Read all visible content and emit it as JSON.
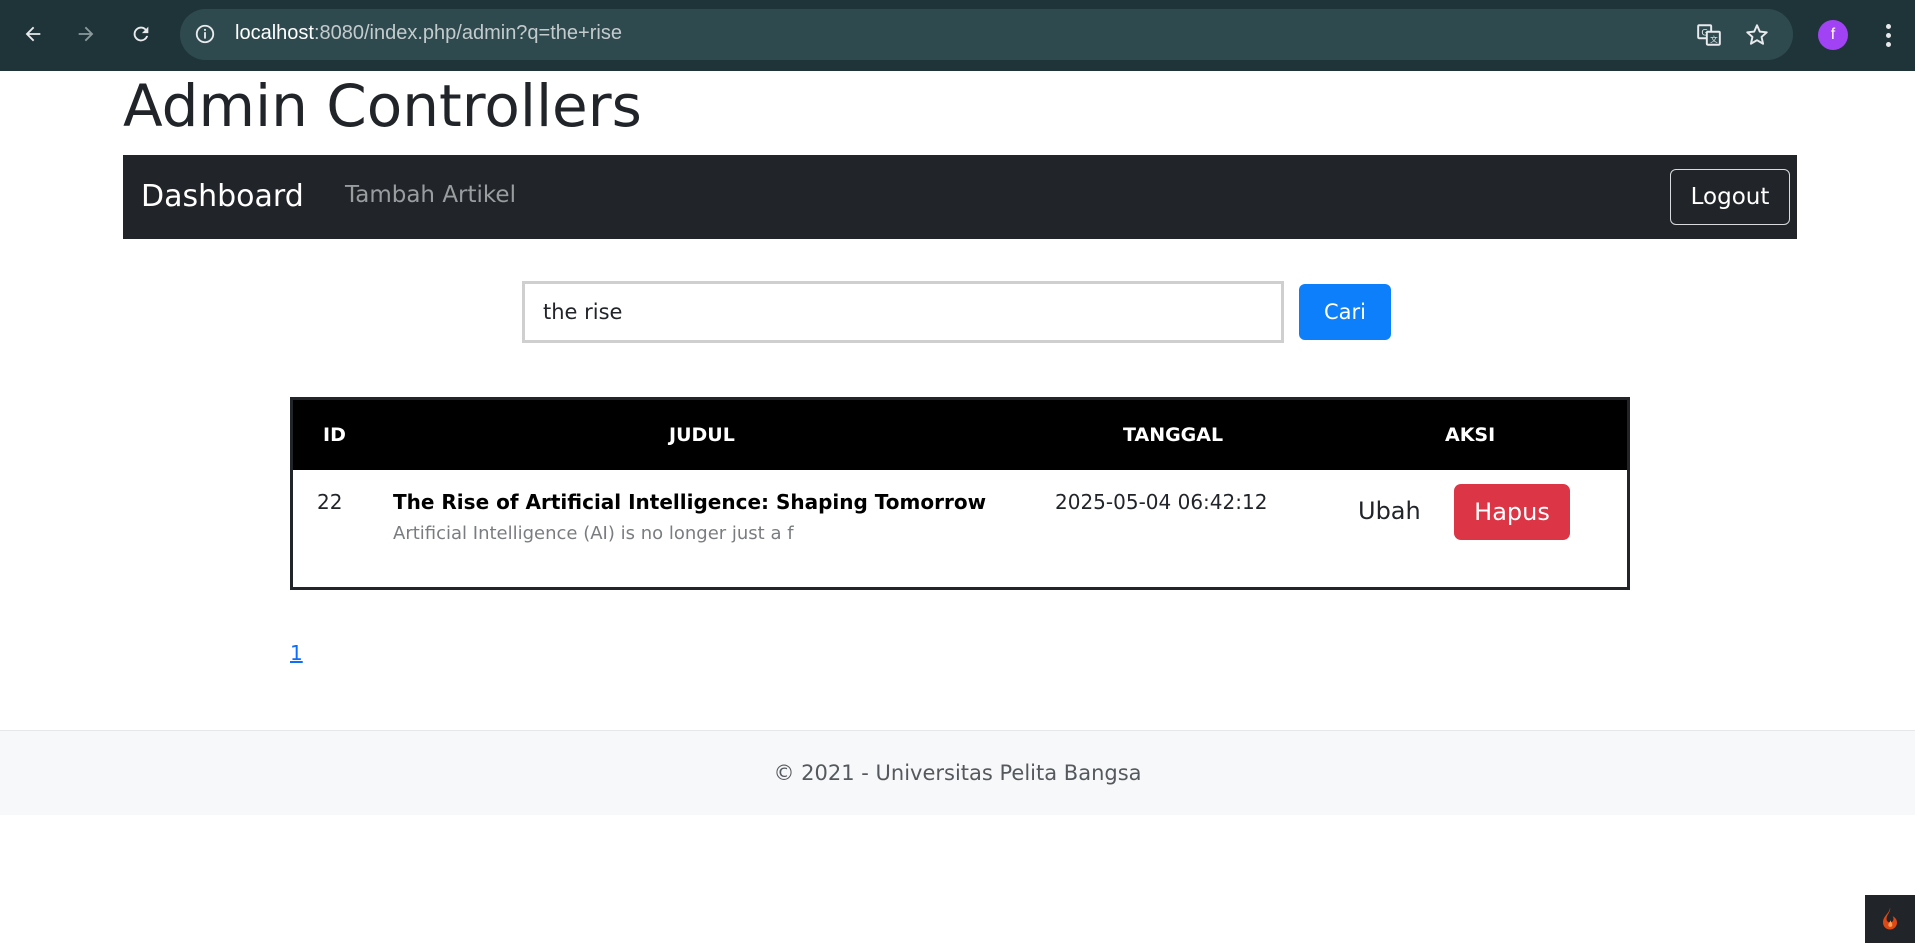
{
  "browser": {
    "url_host": "localhost",
    "url_path": ":8080/index.php/admin?q=the+rise",
    "profile_initial": "f"
  },
  "page": {
    "title": "Admin Controllers"
  },
  "navbar": {
    "brand": "Dashboard",
    "links": [
      "Tambah Artikel"
    ],
    "logout_label": "Logout"
  },
  "search": {
    "value": "the rise",
    "button_label": "Cari"
  },
  "table": {
    "headers": [
      "ID",
      "JUDUL",
      "TANGGAL",
      "AKSI"
    ],
    "rows": [
      {
        "id": "22",
        "title": "The Rise of Artificial Intelligence: Shaping Tomorrow",
        "excerpt": "Artificial Intelligence (AI) is no longer just a f",
        "date": "2025-05-04 06:42:12",
        "edit_label": "Ubah",
        "delete_label": "Hapus"
      }
    ]
  },
  "pagination": {
    "pages": [
      "1"
    ]
  },
  "footer": {
    "text": "© 2021 - Universitas Pelita Bangsa"
  },
  "colors": {
    "chrome_bg": "#1f3438",
    "navbar_bg": "#212529",
    "primary": "#0d7ffb",
    "danger": "#dc3545",
    "avatar": "#a142f4"
  }
}
